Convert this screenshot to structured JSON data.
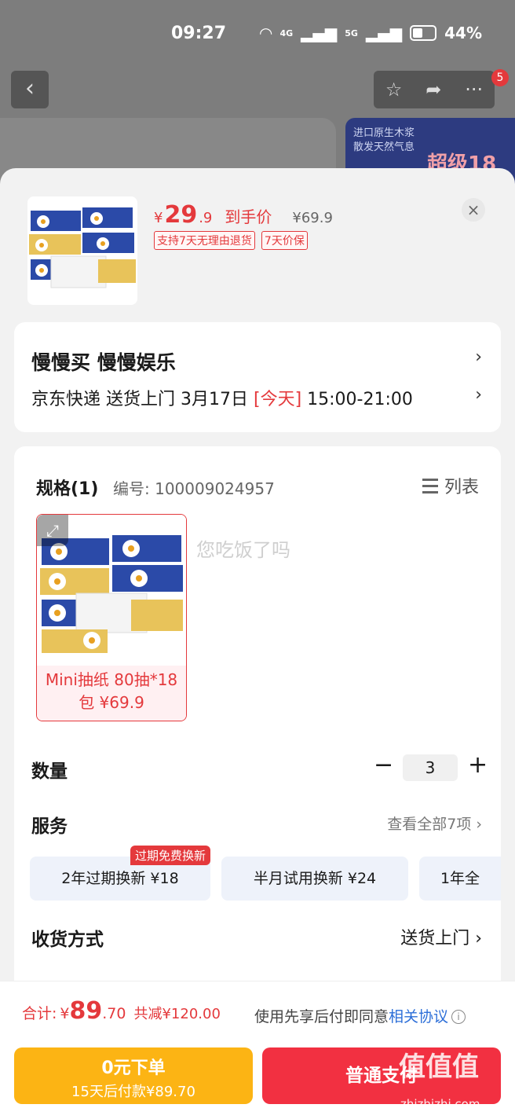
{
  "status": {
    "time": "09:27",
    "net1": "4G",
    "net2": "5G",
    "battery": "44%"
  },
  "topbar": {
    "back": "‹",
    "star": "☆",
    "share": "➦",
    "more": "···",
    "badge": "5"
  },
  "bg_banner": {
    "line1": "进口原生木浆",
    "line2": "散发天然气息",
    "promo": "超级18"
  },
  "product": {
    "price_symbol": "¥",
    "price_int": "29",
    "price_dec": ".9",
    "price_tag": "到手价",
    "orig_price": "¥69.9",
    "tags": [
      "支持7天无理由退货",
      "7天价保"
    ]
  },
  "close": "×",
  "store": {
    "name": "慢慢买  慢慢娱乐",
    "delivery_prefix": "京东快递 送货上门 3月17日 ",
    "delivery_today": "[今天]",
    "delivery_window": " 15:00-21:00"
  },
  "spec": {
    "title": "规格(1)",
    "code": "编号: 100009024957",
    "list_label": "列表",
    "option_label_line1": "Mini抽纸 80抽*18",
    "option_label_line2": "包 ¥69.9",
    "watermark": "您吃饭了吗"
  },
  "quantity": {
    "label": "数量",
    "value": "3",
    "minus": "−",
    "plus": "+"
  },
  "service": {
    "label": "服务",
    "view_all": "查看全部7项 ›",
    "badge": "过期免费换新",
    "chips": [
      "2年过期换新  ¥18",
      "半月试用换新  ¥24",
      "1年全"
    ]
  },
  "receive": {
    "label": "收货方式",
    "value": "送货上门  ›"
  },
  "footer": {
    "total_label": "合计:",
    "total_symbol": "¥",
    "total_int": "89",
    "total_dec": ".70",
    "discount": "共减¥120.00",
    "agree_text": "使用先享后付即同意",
    "agree_link": "相关协议",
    "paylater_title": "0元下单",
    "paylater_sub": "15天后付款¥89.70",
    "pay_label": "普通支付"
  },
  "watermark_corner": {
    "line1": "值值值",
    "line2": "zhizhizhi.com"
  }
}
